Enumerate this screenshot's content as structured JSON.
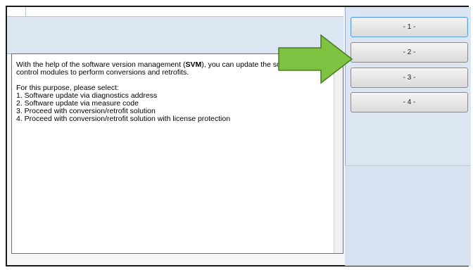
{
  "description_text": {
    "intro_before": "With the help of the software version management (",
    "intro_bold": "SVM",
    "intro_after": "), you can update the software for control modules to perform conversions and retrofits.",
    "select_heading": "For this purpose, please select:",
    "options": [
      "1. Software update via diagnostics address",
      "2. Software update via measure code",
      "3. Proceed with conversion/retrofit solution",
      "4. Proceed with conversion/retrofit solution with license protection"
    ]
  },
  "side_buttons": [
    "- 1 -",
    "- 2 -",
    "- 3 -",
    "- 4 -"
  ],
  "colors": {
    "panel_background": "#dce6f2",
    "arrow_fill": "#7dc241",
    "arrow_stroke": "#4a7a20"
  },
  "icons": {
    "scroll_up": "▲",
    "arrow_annotation": "green-right-arrow-icon"
  }
}
